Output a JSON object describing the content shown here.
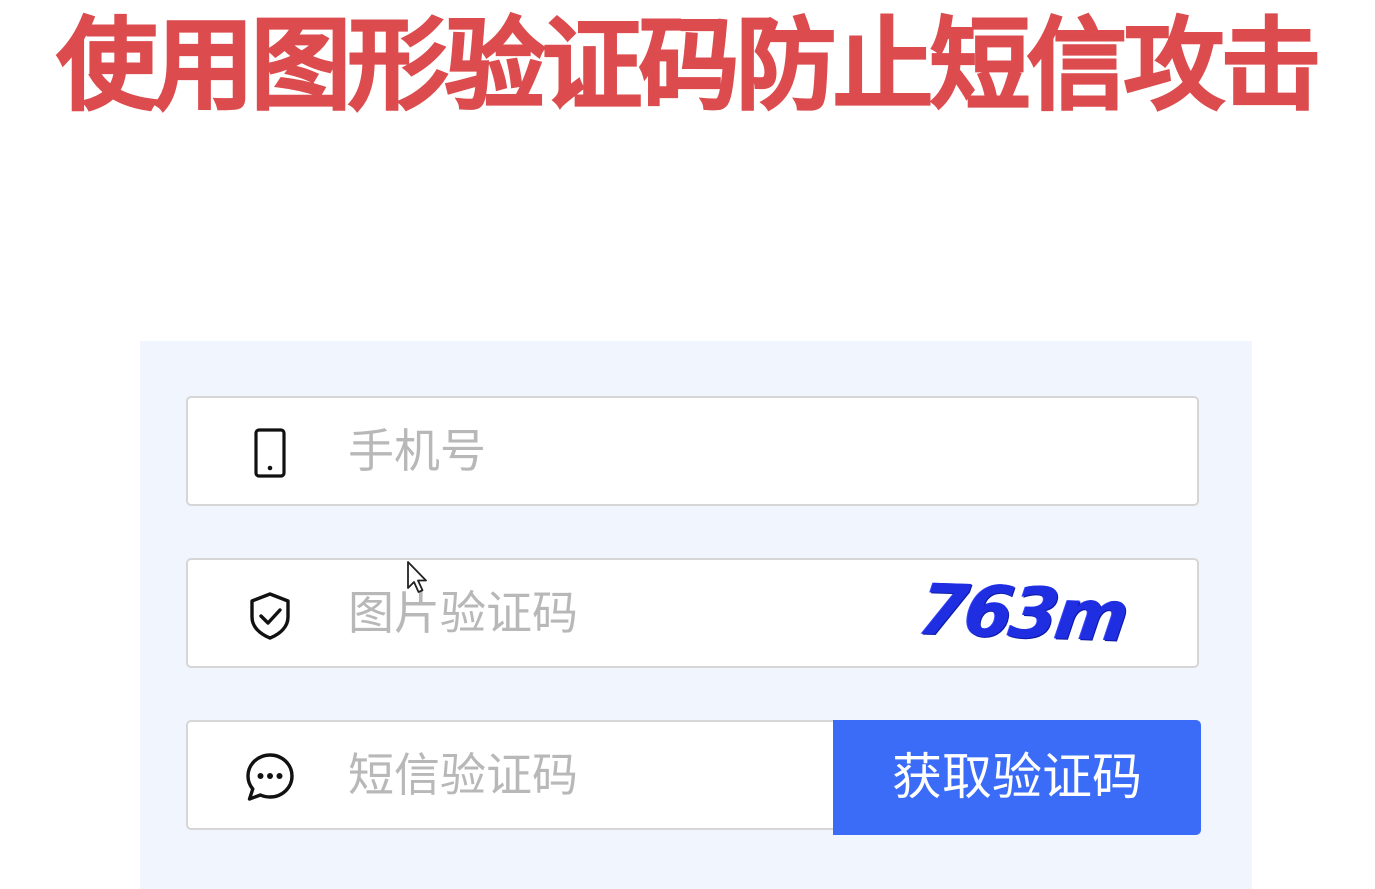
{
  "headline": "使用图形验证码防止短信攻击",
  "form": {
    "phone": {
      "icon": "mobile-phone-icon",
      "placeholder": "手机号",
      "value": ""
    },
    "image_captcha": {
      "icon": "shield-check-icon",
      "placeholder": "图片验证码",
      "value": "",
      "captcha_text": "763m"
    },
    "sms_code": {
      "icon": "chat-bubble-icon",
      "placeholder": "短信验证码",
      "value": "",
      "button_label": "获取验证码"
    }
  },
  "colors": {
    "headline": "#dc4b4d",
    "panel_background": "#f0f5fe",
    "button": "#3b6cf7",
    "captcha_text": "#1f2ee0",
    "placeholder": "#b8b8b8"
  }
}
